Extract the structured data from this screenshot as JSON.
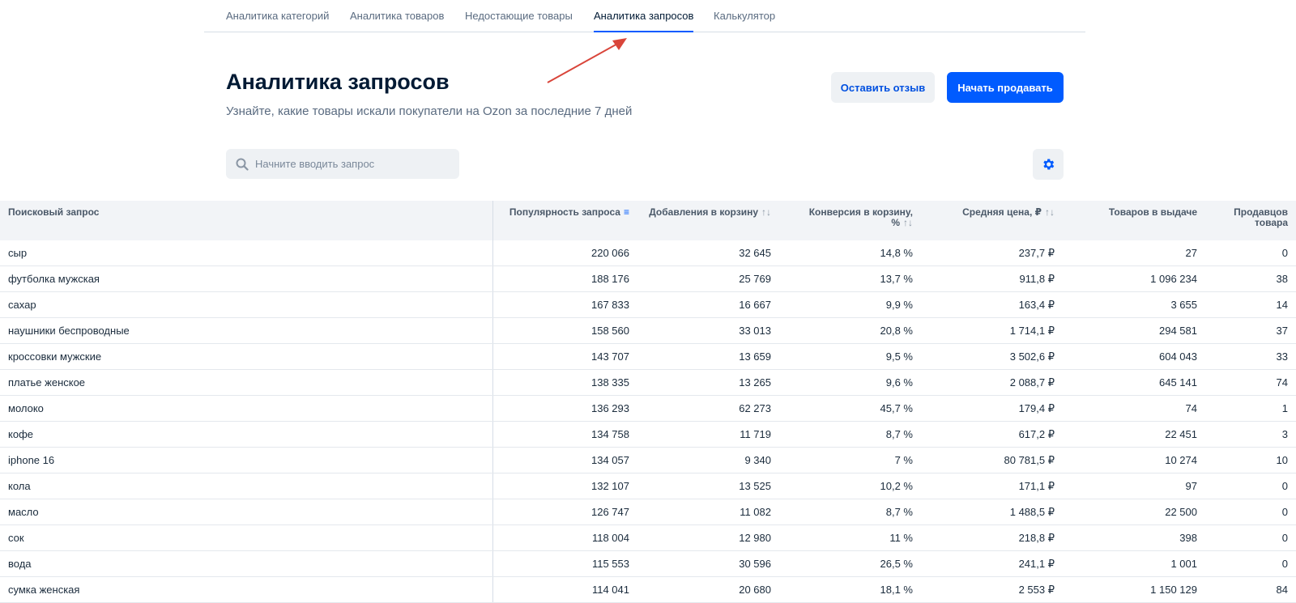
{
  "tabs": [
    {
      "label": "Аналитика категорий"
    },
    {
      "label": "Аналитика товаров"
    },
    {
      "label": "Недостающие товары"
    },
    {
      "label": "Аналитика запросов"
    },
    {
      "label": "Калькулятор"
    }
  ],
  "active_tab": "Аналитика запросов",
  "page": {
    "title": "Аналитика запросов",
    "subtitle": "Узнайте, какие товары искали покупатели на Ozon за последние 7 дней"
  },
  "buttons": {
    "feedback": "Оставить отзыв",
    "sell": "Начать продавать"
  },
  "search": {
    "placeholder": "Начните вводить запрос",
    "value": ""
  },
  "colors": {
    "accent": "#005bff",
    "annotation_arrow": "#d9453a"
  },
  "table": {
    "columns": [
      {
        "label": "Поисковый запрос",
        "sort": ""
      },
      {
        "label": "Популярность запроса",
        "sort": "≡"
      },
      {
        "label": "Добавления в корзину",
        "sort": "↑↓"
      },
      {
        "label": "Конверсия в корзину, %",
        "sort": "↑↓"
      },
      {
        "label": "Средняя цена, ₽",
        "sort": "↑↓"
      },
      {
        "label": "Товаров в выдаче",
        "sort": ""
      },
      {
        "label": "Продавцов товара",
        "sort": ""
      }
    ],
    "rows": [
      [
        "сыр",
        "220 066",
        "32 645",
        "14,8 %",
        "237,7 ₽",
        "27",
        "0"
      ],
      [
        "футболка мужская",
        "188 176",
        "25 769",
        "13,7 %",
        "911,8 ₽",
        "1 096 234",
        "38"
      ],
      [
        "сахар",
        "167 833",
        "16 667",
        "9,9 %",
        "163,4 ₽",
        "3 655",
        "14"
      ],
      [
        "наушники беспроводные",
        "158 560",
        "33 013",
        "20,8 %",
        "1 714,1 ₽",
        "294 581",
        "37"
      ],
      [
        "кроссовки мужские",
        "143 707",
        "13 659",
        "9,5 %",
        "3 502,6 ₽",
        "604 043",
        "33"
      ],
      [
        "платье женское",
        "138 335",
        "13 265",
        "9,6 %",
        "2 088,7 ₽",
        "645 141",
        "74"
      ],
      [
        "молоко",
        "136 293",
        "62 273",
        "45,7 %",
        "179,4 ₽",
        "74",
        "1"
      ],
      [
        "кофе",
        "134 758",
        "11 719",
        "8,7 %",
        "617,2 ₽",
        "22 451",
        "3"
      ],
      [
        "iphone 16",
        "134 057",
        "9 340",
        "7 %",
        "80 781,5 ₽",
        "10 274",
        "10"
      ],
      [
        "кола",
        "132 107",
        "13 525",
        "10,2 %",
        "171,1 ₽",
        "97",
        "0"
      ],
      [
        "масло",
        "126 747",
        "11 082",
        "8,7 %",
        "1 488,5 ₽",
        "22 500",
        "0"
      ],
      [
        "сок",
        "118 004",
        "12 980",
        "11 %",
        "218,8 ₽",
        "398",
        "0"
      ],
      [
        "вода",
        "115 553",
        "30 596",
        "26,5 %",
        "241,1 ₽",
        "1 001",
        "0"
      ],
      [
        "сумка женская",
        "114 041",
        "20 680",
        "18,1 %",
        "2 553 ₽",
        "1 150 129",
        "84"
      ]
    ]
  }
}
